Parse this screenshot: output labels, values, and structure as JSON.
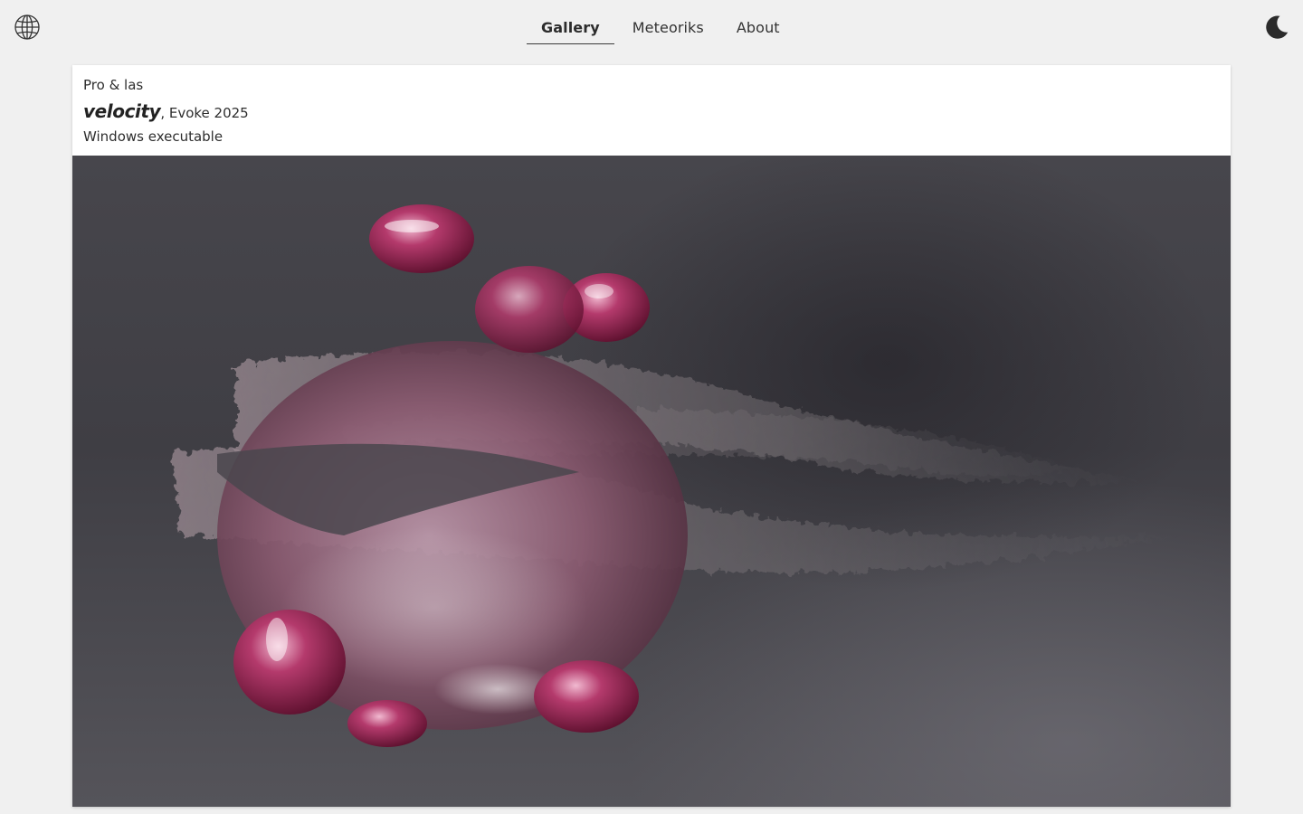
{
  "header": {
    "language_icon": "globe-icon",
    "theme_icon": "moon-icon",
    "nav": {
      "tabs": [
        {
          "label": "Gallery",
          "active": true
        },
        {
          "label": "Meteoriks",
          "active": false
        },
        {
          "label": "About",
          "active": false
        }
      ]
    }
  },
  "entry": {
    "credit": "Pro & las",
    "name": "velocity",
    "event": ", Evoke 2025",
    "platform": "Windows executable"
  },
  "colors": {
    "page_background": "#f0f0f0",
    "card_background": "#ffffff",
    "blob_accent": "#9a2a55"
  }
}
